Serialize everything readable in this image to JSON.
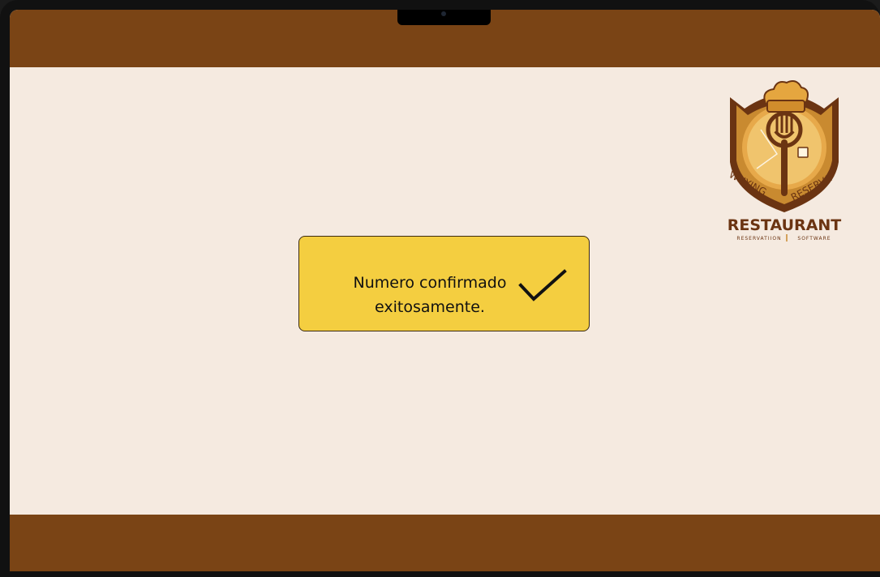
{
  "toast": {
    "line1": "Numero confirmado",
    "line2": "exitosamente.",
    "icon": "checkmark-icon"
  },
  "logo": {
    "arc_left": "WHYING",
    "arc_right": "RESERVA",
    "title": "RESTAURANT",
    "subtitle_left": "RESERVATIION",
    "subtitle_right": "SOFTWARE"
  },
  "colors": {
    "bar": "#7a4415",
    "background": "#f5eae0",
    "toast": "#f4ce40"
  }
}
